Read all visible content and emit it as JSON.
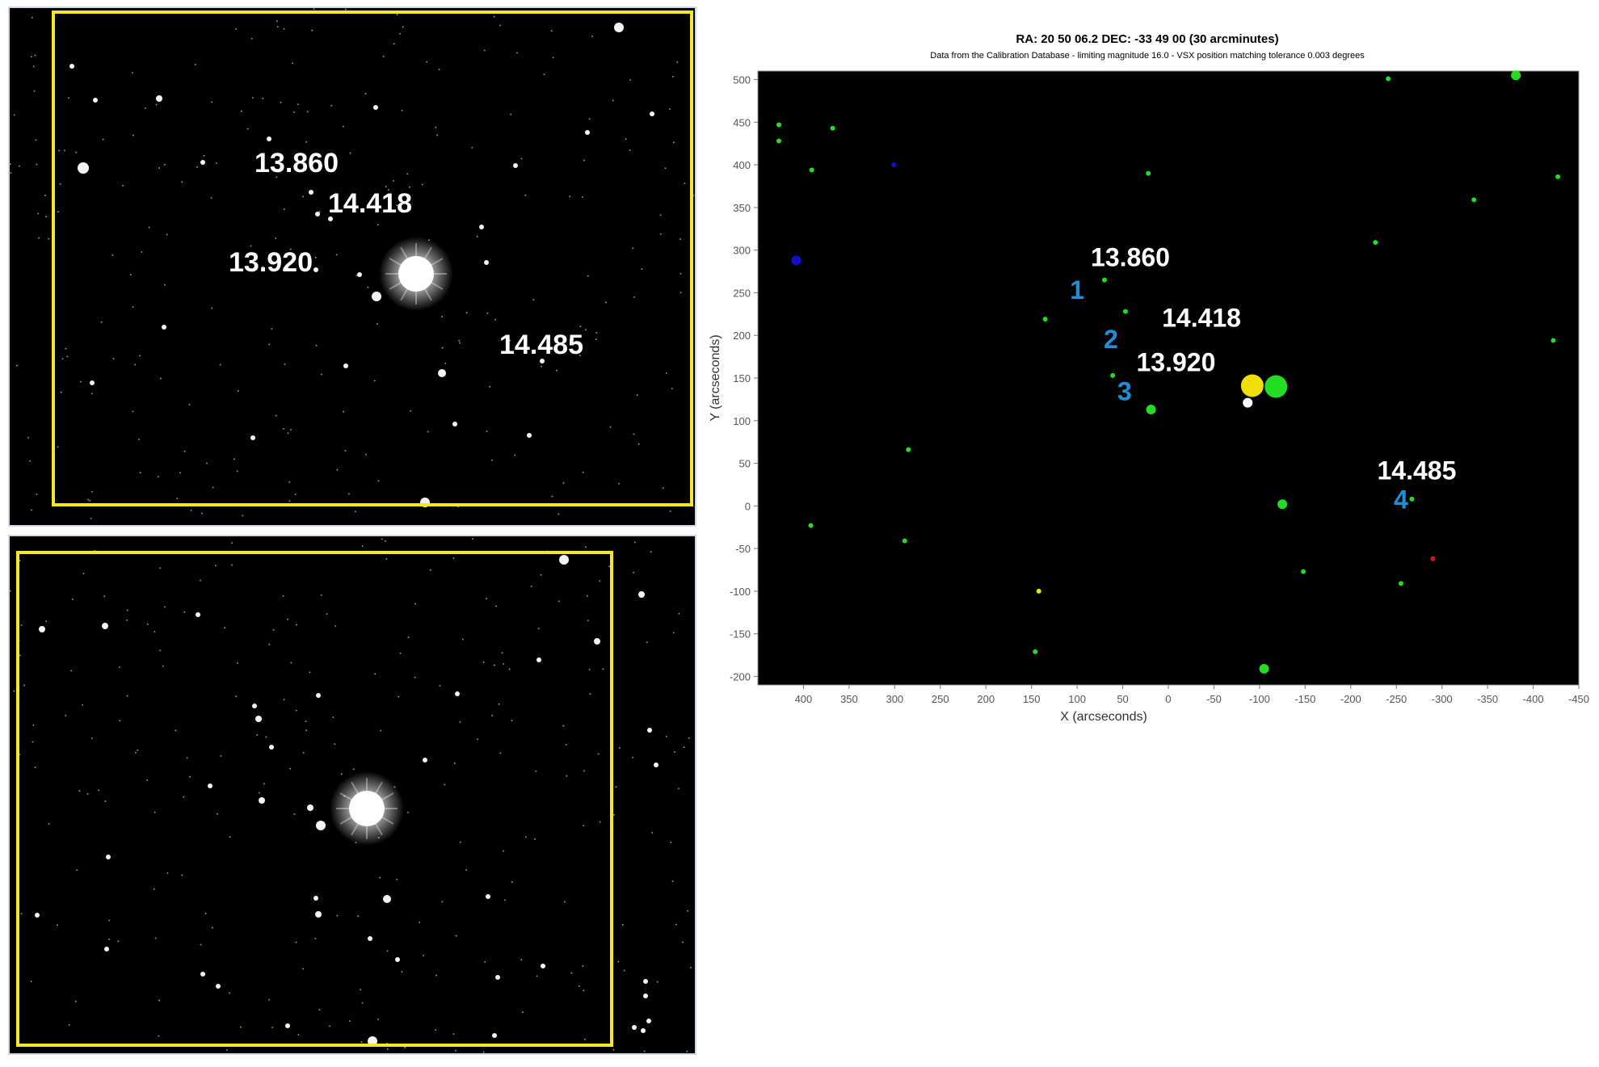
{
  "images": [
    {
      "labels": [
        {
          "text": "13.860"
        },
        {
          "text": "14.418"
        },
        {
          "text": "13.920"
        },
        {
          "text": "14.485"
        }
      ]
    },
    {
      "labels": []
    }
  ],
  "highlight_color": "#f5e628",
  "label_color": "#ffffff",
  "number_color": "#1e90d6",
  "chart_data": {
    "type": "scatter",
    "title": "RA: 20 50 06.2  DEC: -33 49 00 (30 arcminutes)",
    "subtitle": "Data from the Calibration Database - limiting magnitude 16.0 - VSX position matching tolerance 0.003 degrees",
    "xlabel": "X (arcseconds)",
    "ylabel": "Y (arcseconds)",
    "xlim": [
      450,
      -450
    ],
    "ylim": [
      -210,
      510
    ],
    "x_reversed": true,
    "x_ticks": [
      400,
      350,
      300,
      250,
      200,
      150,
      100,
      50,
      0,
      -50,
      -100,
      -150,
      -200,
      -250,
      -300,
      -350,
      -400,
      -450
    ],
    "y_ticks": [
      500,
      450,
      400,
      350,
      300,
      250,
      200,
      150,
      100,
      50,
      0,
      -50,
      -100,
      -150,
      -200
    ],
    "background": "#000000",
    "points": [
      {
        "x": 427,
        "y": 447,
        "color": "#22dd22",
        "size": "small"
      },
      {
        "x": 427,
        "y": 428,
        "color": "#22dd22",
        "size": "small"
      },
      {
        "x": 368,
        "y": 443,
        "color": "#22dd22",
        "size": "small"
      },
      {
        "x": 391,
        "y": 394,
        "color": "#22dd22",
        "size": "small"
      },
      {
        "x": 301,
        "y": 400,
        "color": "#1010cc",
        "size": "small"
      },
      {
        "x": 408,
        "y": 288,
        "color": "#1010cc",
        "size": "medium"
      },
      {
        "x": 22,
        "y": 390,
        "color": "#22dd22",
        "size": "small"
      },
      {
        "x": -241,
        "y": 501,
        "color": "#22dd22",
        "size": "small"
      },
      {
        "x": -381,
        "y": 505,
        "color": "#22dd22",
        "size": "medium"
      },
      {
        "x": -335,
        "y": 359,
        "color": "#22dd22",
        "size": "small"
      },
      {
        "x": -427,
        "y": 386,
        "color": "#22dd22",
        "size": "small"
      },
      {
        "x": -227,
        "y": 309,
        "color": "#22dd22",
        "size": "small"
      },
      {
        "x": -422,
        "y": 194,
        "color": "#22dd22",
        "size": "small"
      },
      {
        "x": 70,
        "y": 265,
        "color": "#22dd22",
        "size": "small"
      },
      {
        "x": 47,
        "y": 228,
        "color": "#22dd22",
        "size": "small"
      },
      {
        "x": 135,
        "y": 219,
        "color": "#22dd22",
        "size": "small"
      },
      {
        "x": 61,
        "y": 153,
        "color": "#22dd22",
        "size": "small"
      },
      {
        "x": 19,
        "y": 113,
        "color": "#22dd22",
        "size": "medium"
      },
      {
        "x": -92,
        "y": 141,
        "color": "#f0e000",
        "size": "large"
      },
      {
        "x": -118,
        "y": 140,
        "color": "#22dd22",
        "size": "large"
      },
      {
        "x": -87,
        "y": 121,
        "color": "#ffffff",
        "size": "medium"
      },
      {
        "x": 285,
        "y": 66,
        "color": "#22dd22",
        "size": "small"
      },
      {
        "x": -125,
        "y": 2,
        "color": "#22dd22",
        "size": "medium"
      },
      {
        "x": -267,
        "y": 8,
        "color": "#22dd22",
        "size": "small"
      },
      {
        "x": 392,
        "y": -23,
        "color": "#22dd22",
        "size": "small"
      },
      {
        "x": 289,
        "y": -41,
        "color": "#22dd22",
        "size": "small"
      },
      {
        "x": -290,
        "y": -62,
        "color": "#dd1111",
        "size": "small"
      },
      {
        "x": -148,
        "y": -77,
        "color": "#22dd22",
        "size": "small"
      },
      {
        "x": -255,
        "y": -91,
        "color": "#22dd22",
        "size": "small"
      },
      {
        "x": 142,
        "y": -100,
        "color": "#f0e000",
        "size": "small"
      },
      {
        "x": 146,
        "y": -171,
        "color": "#22dd22",
        "size": "small"
      },
      {
        "x": -105,
        "y": -191,
        "color": "#22dd22",
        "size": "medium"
      }
    ],
    "annotations": [
      {
        "text": "13.860",
        "kind": "magnitude"
      },
      {
        "text": "1",
        "kind": "number"
      },
      {
        "text": "14.418",
        "kind": "magnitude"
      },
      {
        "text": "2",
        "kind": "number"
      },
      {
        "text": "13.920",
        "kind": "magnitude"
      },
      {
        "text": "3",
        "kind": "number"
      },
      {
        "text": "14.485",
        "kind": "magnitude"
      },
      {
        "text": "4",
        "kind": "number"
      }
    ]
  }
}
